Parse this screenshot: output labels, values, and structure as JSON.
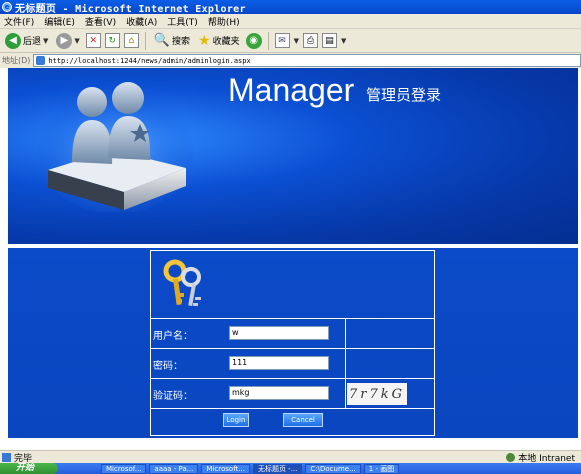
{
  "window": {
    "title": "无标题页 - Microsoft Internet Explorer"
  },
  "menu": [
    "文件(F)",
    "编辑(E)",
    "查看(V)",
    "收藏(A)",
    "工具(T)",
    "帮助(H)"
  ],
  "toolbar": {
    "back_label": "后退",
    "search_label": "搜索",
    "favorites_label": "收藏夹"
  },
  "address": {
    "label": "地址(D)",
    "url": "http://localhost:1244/news/admin/adminlogin.aspx"
  },
  "banner": {
    "title": "Manager",
    "subtitle": "管理员登录"
  },
  "form": {
    "username_label": "用户名：",
    "username_value": "w",
    "password_label": "密码：",
    "password_value": "111",
    "captcha_label": "验证码：",
    "captcha_value": "mkg",
    "captcha_image_text": "7r7kG",
    "login_button": "Login",
    "cancel_button": "Cancel"
  },
  "status": {
    "left": "完毕",
    "right": "本地 Intranet"
  },
  "taskbar": {
    "start": "开始",
    "tasks": [
      "Microsof...",
      "aaaa - Pa...",
      "Microsoft...",
      "无标题页 -...",
      "C:\\Docume...",
      "1 - 画图"
    ]
  },
  "colors": {
    "banner_blue": "#0b4fd2",
    "panel_blue": "#0a46bf",
    "titlebar_blue": "#0a5ee6"
  }
}
